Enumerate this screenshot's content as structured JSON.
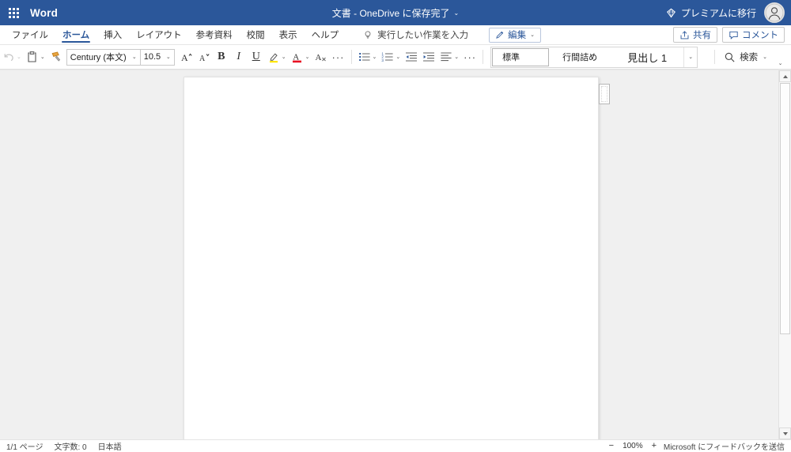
{
  "titlebar": {
    "app_launcher_icon": "waffle-grid-icon",
    "app_name": "Word",
    "document_title": "文書 - OneDrive に保存完了",
    "title_chevron": "⌄",
    "premium_icon": "diamond-icon",
    "premium_label": "プレミアムに移行",
    "avatar_icon": "user-avatar-icon",
    "brand_color": "#2b579a"
  },
  "tabs": [
    {
      "label": "ファイル",
      "active": false
    },
    {
      "label": "ホーム",
      "active": true
    },
    {
      "label": "挿入",
      "active": false
    },
    {
      "label": "レイアウト",
      "active": false
    },
    {
      "label": "参考資料",
      "active": false
    },
    {
      "label": "校閲",
      "active": false
    },
    {
      "label": "表示",
      "active": false
    },
    {
      "label": "ヘルプ",
      "active": false
    }
  ],
  "tellme": {
    "icon": "lightbulb-icon",
    "placeholder": "実行したい作業を入力"
  },
  "edit_button": {
    "icon": "pencil-icon",
    "label": "編集",
    "chevron": "⌄"
  },
  "tabstrip_right": {
    "share_icon": "share-icon",
    "share_label": "共有",
    "comments_icon": "comment-icon",
    "comments_label": "コメント"
  },
  "ribbon": {
    "undo": {
      "icon": "undo-icon",
      "chevron": "⌄",
      "disabled": true
    },
    "paste": {
      "icon": "clipboard-icon",
      "chevron": "⌄"
    },
    "format_painter": {
      "icon": "format-painter-icon"
    },
    "font_name": "Century (本文)",
    "font_size": "10.5",
    "grow_font": {
      "icon": "grow-font-icon",
      "glyph": "A"
    },
    "shrink_font": {
      "icon": "shrink-font-icon",
      "glyph": "A"
    },
    "bold": {
      "icon": "bold-icon",
      "glyph": "B"
    },
    "italic": {
      "icon": "italic-icon",
      "glyph": "I"
    },
    "underline": {
      "icon": "underline-icon",
      "glyph": "U"
    },
    "highlight": {
      "icon": "text-highlight-icon",
      "glyph": "✎",
      "color": "#ffe600",
      "chevron": "⌄"
    },
    "font_color": {
      "icon": "font-color-icon",
      "glyph": "A",
      "color": "#e81123",
      "chevron": "⌄"
    },
    "clear_formatting": {
      "icon": "clear-formatting-icon",
      "glyph": "A"
    },
    "more_font": {
      "icon": "more-options-icon",
      "glyph": "···"
    },
    "bullets": {
      "icon": "bulleted-list-icon",
      "chevron": "⌄"
    },
    "numbering": {
      "icon": "numbered-list-icon",
      "chevron": "⌄"
    },
    "decrease_indent": {
      "icon": "decrease-indent-icon"
    },
    "increase_indent": {
      "icon": "increase-indent-icon"
    },
    "alignment": {
      "icon": "align-left-icon",
      "chevron": "⌄"
    },
    "more_paragraph": {
      "icon": "more-options-icon",
      "glyph": "···"
    },
    "styles": [
      {
        "label": "標準",
        "selected": true
      },
      {
        "label": "行間詰め",
        "selected": false
      },
      {
        "label": "見出し 1",
        "selected": false
      }
    ],
    "styles_chevron": "⌄",
    "search": {
      "icon": "search-icon",
      "label": "検索",
      "chevron": "⌄"
    },
    "collapse_ribbon": {
      "icon": "chevron-down-icon",
      "glyph": "⌄"
    }
  },
  "canvas": {
    "page_background": "#ffffff",
    "canvas_background": "#f0f0f0",
    "page_handle_icon": "page-handle-icon",
    "scrollbar": {
      "up_arrow_icon": "scroll-up-arrow-icon",
      "down_arrow_icon": "scroll-down-arrow-icon",
      "thumb_icon": "scrollbar-thumb"
    }
  },
  "statusbar": {
    "page_count": "1/1 ページ",
    "word_count": "文字数: 0",
    "language": "日本語",
    "zoom_out": "−",
    "zoom_level": "100%",
    "zoom_in": "+",
    "feedback": "Microsoft にフィードバックを送信"
  }
}
